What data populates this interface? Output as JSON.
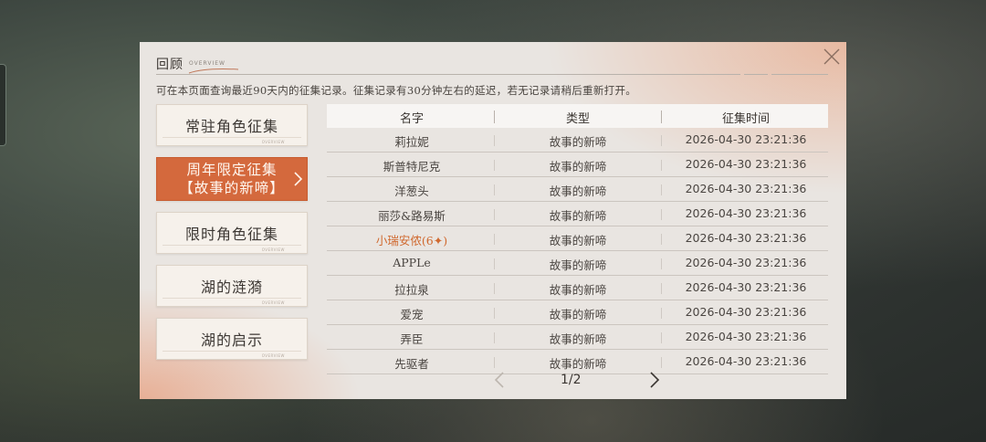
{
  "header": {
    "title": "回顾",
    "subtitle": "OVERVIEW",
    "notice": "可在本页面查询最近90天内的征集记录。征集记录有30分钟左右的延迟，若无记录请稍后重新打开。"
  },
  "tabs": [
    {
      "label": "常驻角色征集",
      "active": false
    },
    {
      "label": "周年限定征集\n【故事的新啼】",
      "active": true
    },
    {
      "label": "限时角色征集",
      "active": false
    },
    {
      "label": "湖的涟漪",
      "active": false
    },
    {
      "label": "湖的启示",
      "active": false
    }
  ],
  "tab_deco_text": "OVERVIEW",
  "table": {
    "columns": [
      "名字",
      "类型",
      "征集时间"
    ],
    "rows": [
      {
        "name": "莉拉妮",
        "type": "故事的新啼",
        "time": "2026-04-30 23:21:36",
        "highlight": false
      },
      {
        "name": "斯普特尼克",
        "type": "故事的新啼",
        "time": "2026-04-30 23:21:36",
        "highlight": false
      },
      {
        "name": "洋葱头",
        "type": "故事的新啼",
        "time": "2026-04-30 23:21:36",
        "highlight": false
      },
      {
        "name": "丽莎&路易斯",
        "type": "故事的新啼",
        "time": "2026-04-30 23:21:36",
        "highlight": false
      },
      {
        "name": "小瑞安侬(6✦)",
        "type": "故事的新啼",
        "time": "2026-04-30 23:21:36",
        "highlight": true
      },
      {
        "name": "APPLe",
        "type": "故事的新啼",
        "time": "2026-04-30 23:21:36",
        "highlight": false
      },
      {
        "name": "拉拉泉",
        "type": "故事的新啼",
        "time": "2026-04-30 23:21:36",
        "highlight": false
      },
      {
        "name": "爱宠",
        "type": "故事的新啼",
        "time": "2026-04-30 23:21:36",
        "highlight": false
      },
      {
        "name": "弄臣",
        "type": "故事的新啼",
        "time": "2026-04-30 23:21:36",
        "highlight": false
      },
      {
        "name": "先驱者",
        "type": "故事的新啼",
        "time": "2026-04-30 23:21:36",
        "highlight": false
      }
    ]
  },
  "pager": {
    "text": "1/2"
  },
  "colors": {
    "accent": "#d4693d",
    "highlight_text": "#d0692f",
    "panel_bg": "#e9e5e1"
  }
}
